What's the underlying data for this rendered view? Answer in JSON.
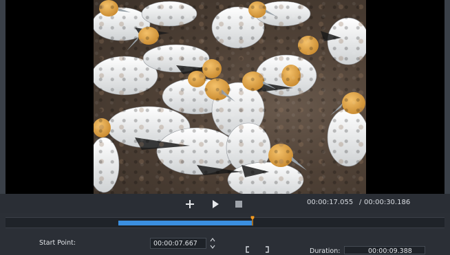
{
  "player": {
    "current_time": "00:00:17.055",
    "separator": "/",
    "total_time": "00:00:30.186"
  },
  "icons": {
    "add": "plus-icon",
    "play": "play-icon",
    "stop": "stop-icon",
    "set_mark": "bracket-icon",
    "stepper_up": "chevron-up-icon",
    "stepper_down": "chevron-down-icon"
  },
  "colors": {
    "accent_blue": "#3b8fe0",
    "playhead_orange": "#f39a1f",
    "panel_bg": "#2b2f36",
    "preview_bg": "#000000"
  },
  "trim": {
    "start_label": "Start Point:",
    "start_value": "00:00:07.667",
    "duration_label": "Duration:",
    "duration_value": "00:00:09.388"
  }
}
